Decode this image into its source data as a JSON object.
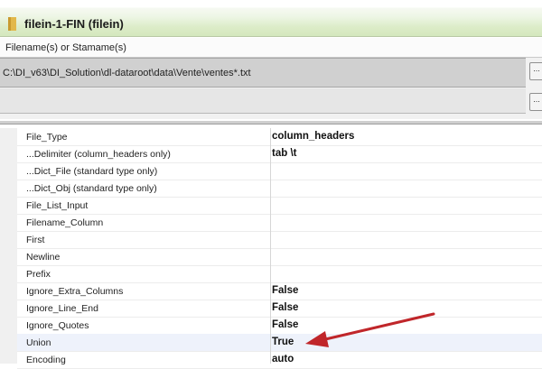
{
  "window": {
    "title": "filein-1-FIN (filein)"
  },
  "file_panel": {
    "label": "Filename(s) or Stamame(s)",
    "path": "C:\\DI_v63\\DI_Solution\\dl-dataroot\\data\\Vente\\ventes*.txt",
    "browse_label": "..."
  },
  "properties": [
    {
      "name": "File_Type",
      "value": "column_headers"
    },
    {
      "name": "...Delimiter (column_headers only)",
      "value": "tab \\t"
    },
    {
      "name": "...Dict_File (standard type only)",
      "value": ""
    },
    {
      "name": "...Dict_Obj (standard type only)",
      "value": ""
    },
    {
      "name": "File_List_Input",
      "value": ""
    },
    {
      "name": "Filename_Column",
      "value": ""
    },
    {
      "name": "First",
      "value": ""
    },
    {
      "name": "Newline",
      "value": ""
    },
    {
      "name": "Prefix",
      "value": ""
    },
    {
      "name": "Ignore_Extra_Columns",
      "value": "False"
    },
    {
      "name": "Ignore_Line_End",
      "value": "False"
    },
    {
      "name": "Ignore_Quotes",
      "value": "False"
    },
    {
      "name": "Union",
      "value": "True"
    },
    {
      "name": "Encoding",
      "value": "auto"
    }
  ],
  "colors": {
    "title_bar": "#d4e7be",
    "arrow": "#c0262a",
    "folder": "#e2b84a",
    "highlight_row": "#eef2fb"
  },
  "icons": {
    "title": "folder-icon",
    "annotation": "red-arrow-icon"
  },
  "annotation": {
    "target_property": "Union"
  }
}
